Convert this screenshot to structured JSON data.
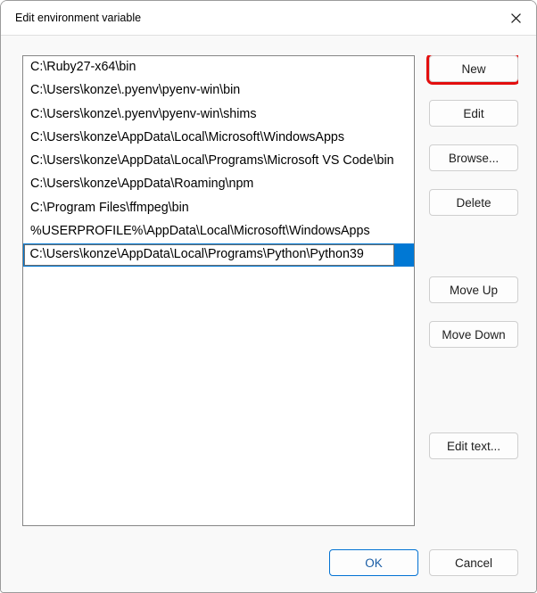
{
  "titlebar": {
    "title": "Edit environment variable"
  },
  "list": {
    "items": [
      "C:\\Ruby27-x64\\bin",
      "C:\\Users\\konze\\.pyenv\\pyenv-win\\bin",
      "C:\\Users\\konze\\.pyenv\\pyenv-win\\shims",
      "C:\\Users\\konze\\AppData\\Local\\Microsoft\\WindowsApps",
      "C:\\Users\\konze\\AppData\\Local\\Programs\\Microsoft VS Code\\bin",
      "C:\\Users\\konze\\AppData\\Roaming\\npm",
      "C:\\Program Files\\ffmpeg\\bin",
      "%USERPROFILE%\\AppData\\Local\\Microsoft\\WindowsApps"
    ],
    "editing_value": "C:\\Users\\konze\\AppData\\Local\\Programs\\Python\\Python39"
  },
  "buttons": {
    "new": "New",
    "edit": "Edit",
    "browse": "Browse...",
    "delete": "Delete",
    "move_up": "Move Up",
    "move_down": "Move Down",
    "edit_text": "Edit text...",
    "ok": "OK",
    "cancel": "Cancel"
  }
}
